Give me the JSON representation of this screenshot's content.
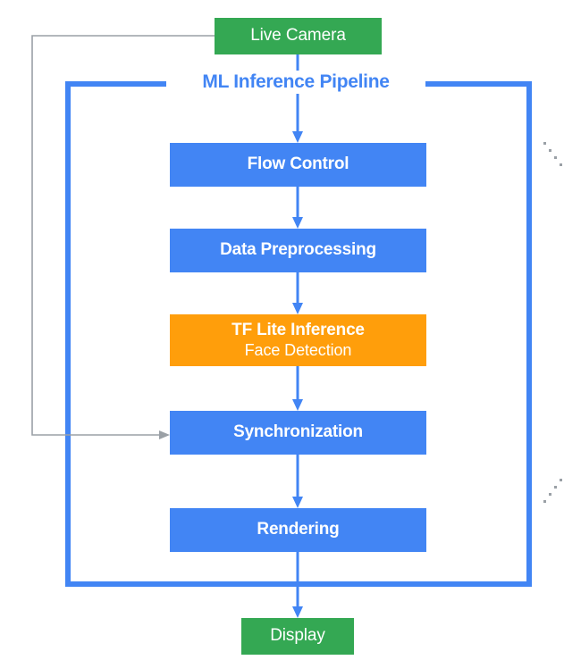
{
  "diagram": {
    "title": "ML Inference Pipeline",
    "nodes": {
      "live_camera": {
        "label": "Live Camera",
        "color": "#34A853",
        "shape": "rectangle"
      },
      "flow_control": {
        "label": "Flow Control",
        "color": "#4285F4",
        "shape": "rectangle"
      },
      "data_preprocessing": {
        "label": "Data Preprocessing",
        "color": "#4285F4",
        "shape": "rectangle"
      },
      "tflite_inference": {
        "label": "TF Lite Inference",
        "sublabel": "Face Detection",
        "color": "#FF9E0B",
        "shape": "rectangle"
      },
      "synchronization": {
        "label": "Synchronization",
        "color": "#4285F4",
        "shape": "rectangle"
      },
      "rendering": {
        "label": "Rendering",
        "color": "#4285F4",
        "shape": "rectangle"
      },
      "display": {
        "label": "Display",
        "color": "#34A853",
        "shape": "rectangle"
      }
    },
    "container": {
      "label": "ML Inference Pipeline",
      "border_color": "#4285F4",
      "border_width": 6
    },
    "edges": [
      {
        "from": "live_camera",
        "to": "flow_control",
        "style": "solid",
        "color": "#4285F4"
      },
      {
        "from": "flow_control",
        "to": "data_preprocessing",
        "style": "solid",
        "color": "#4285F4"
      },
      {
        "from": "data_preprocessing",
        "to": "tflite_inference",
        "style": "solid",
        "color": "#4285F4"
      },
      {
        "from": "tflite_inference",
        "to": "synchronization",
        "style": "solid",
        "color": "#4285F4"
      },
      {
        "from": "synchronization",
        "to": "rendering",
        "style": "solid",
        "color": "#4285F4"
      },
      {
        "from": "rendering",
        "to": "display",
        "style": "solid",
        "color": "#4285F4"
      },
      {
        "from": "live_camera",
        "to": "synchronization",
        "style": "solid",
        "color": "#9AA0A6",
        "routing": "left-feedback"
      }
    ],
    "decorations": {
      "dotted_marks_color": "#9AA0A6"
    }
  }
}
